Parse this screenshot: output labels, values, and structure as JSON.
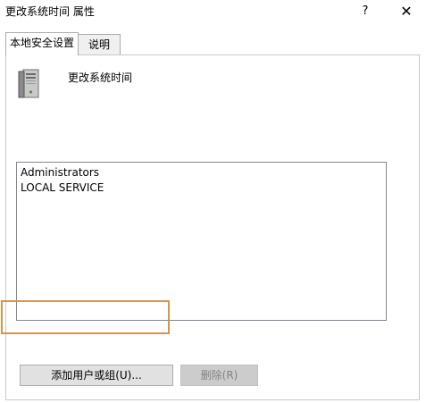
{
  "window": {
    "title": "更改系统时间 属性",
    "help_label": "?",
    "close_label": "✕"
  },
  "tabs": [
    {
      "label": "本地安全设置",
      "active": true
    },
    {
      "label": "说明",
      "active": false
    }
  ],
  "policy": {
    "icon": "computer-tower-icon",
    "name": "更改系统时间"
  },
  "members": [
    "Administrators",
    "LOCAL SERVICE"
  ],
  "buttons": {
    "add_label": "添加用户或组(U)...",
    "remove_label": "删除(R)"
  },
  "colors": {
    "highlight": "#d9934a",
    "panel_border": "#c8c8c8",
    "listbox_border": "#828790",
    "disabled_text": "#838383"
  }
}
